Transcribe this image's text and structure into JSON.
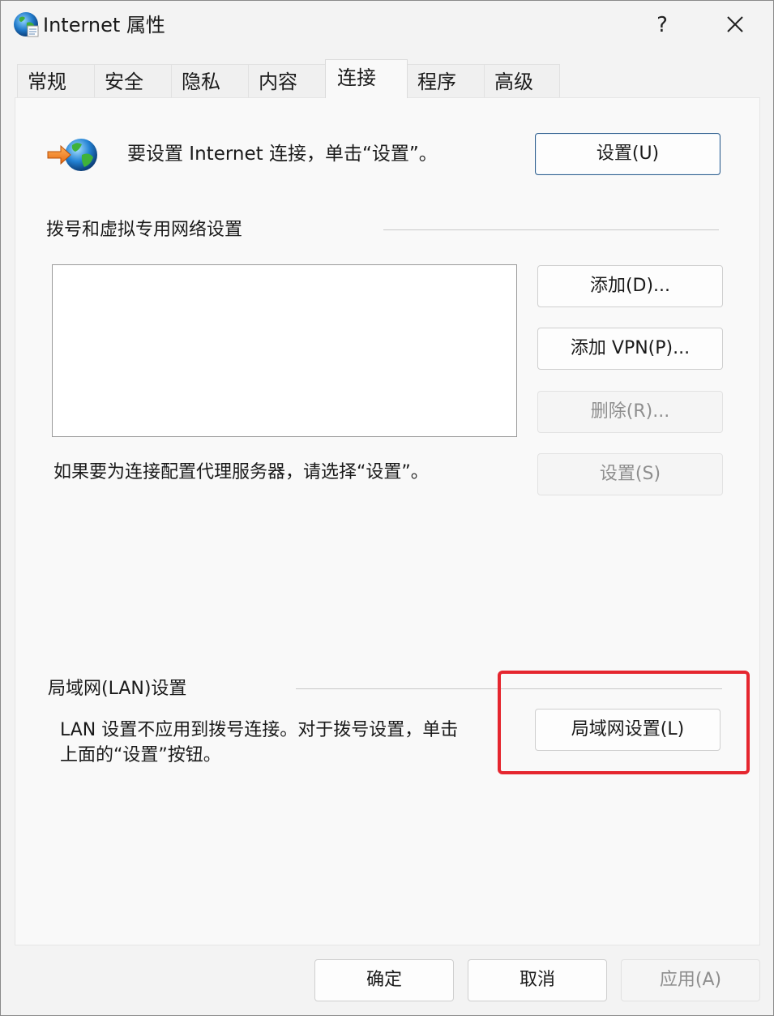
{
  "window": {
    "title": "Internet 属性",
    "help_label": "?",
    "icon": "globe-icon"
  },
  "tabs": [
    {
      "label": "常规"
    },
    {
      "label": "安全"
    },
    {
      "label": "隐私"
    },
    {
      "label": "内容"
    },
    {
      "label": "连接",
      "active": true
    },
    {
      "label": "程序"
    },
    {
      "label": "高级"
    }
  ],
  "setup": {
    "text": "要设置 Internet 连接，单击“设置”。",
    "button": "设置(U)"
  },
  "dialup": {
    "heading": "拨号和虚拟专用网络设置",
    "add_button": "添加(D)...",
    "add_vpn_button": "添加 VPN(P)...",
    "remove_button": "删除(R)...",
    "proxy_text": "如果要为连接配置代理服务器，请选择“设置”。",
    "settings_button": "设置(S)"
  },
  "lan": {
    "heading": "局域网(LAN)设置",
    "desc_line1": "LAN 设置不应用到拨号连接。对于拨号设置，单击",
    "desc_line2": "上面的“设置”按钮。",
    "button": "局域网设置(L)"
  },
  "footer": {
    "ok": "确定",
    "cancel": "取消",
    "apply": "应用(A)"
  },
  "colors": {
    "highlight": "#e5262f",
    "default_button_border": "#2f5f8e"
  }
}
